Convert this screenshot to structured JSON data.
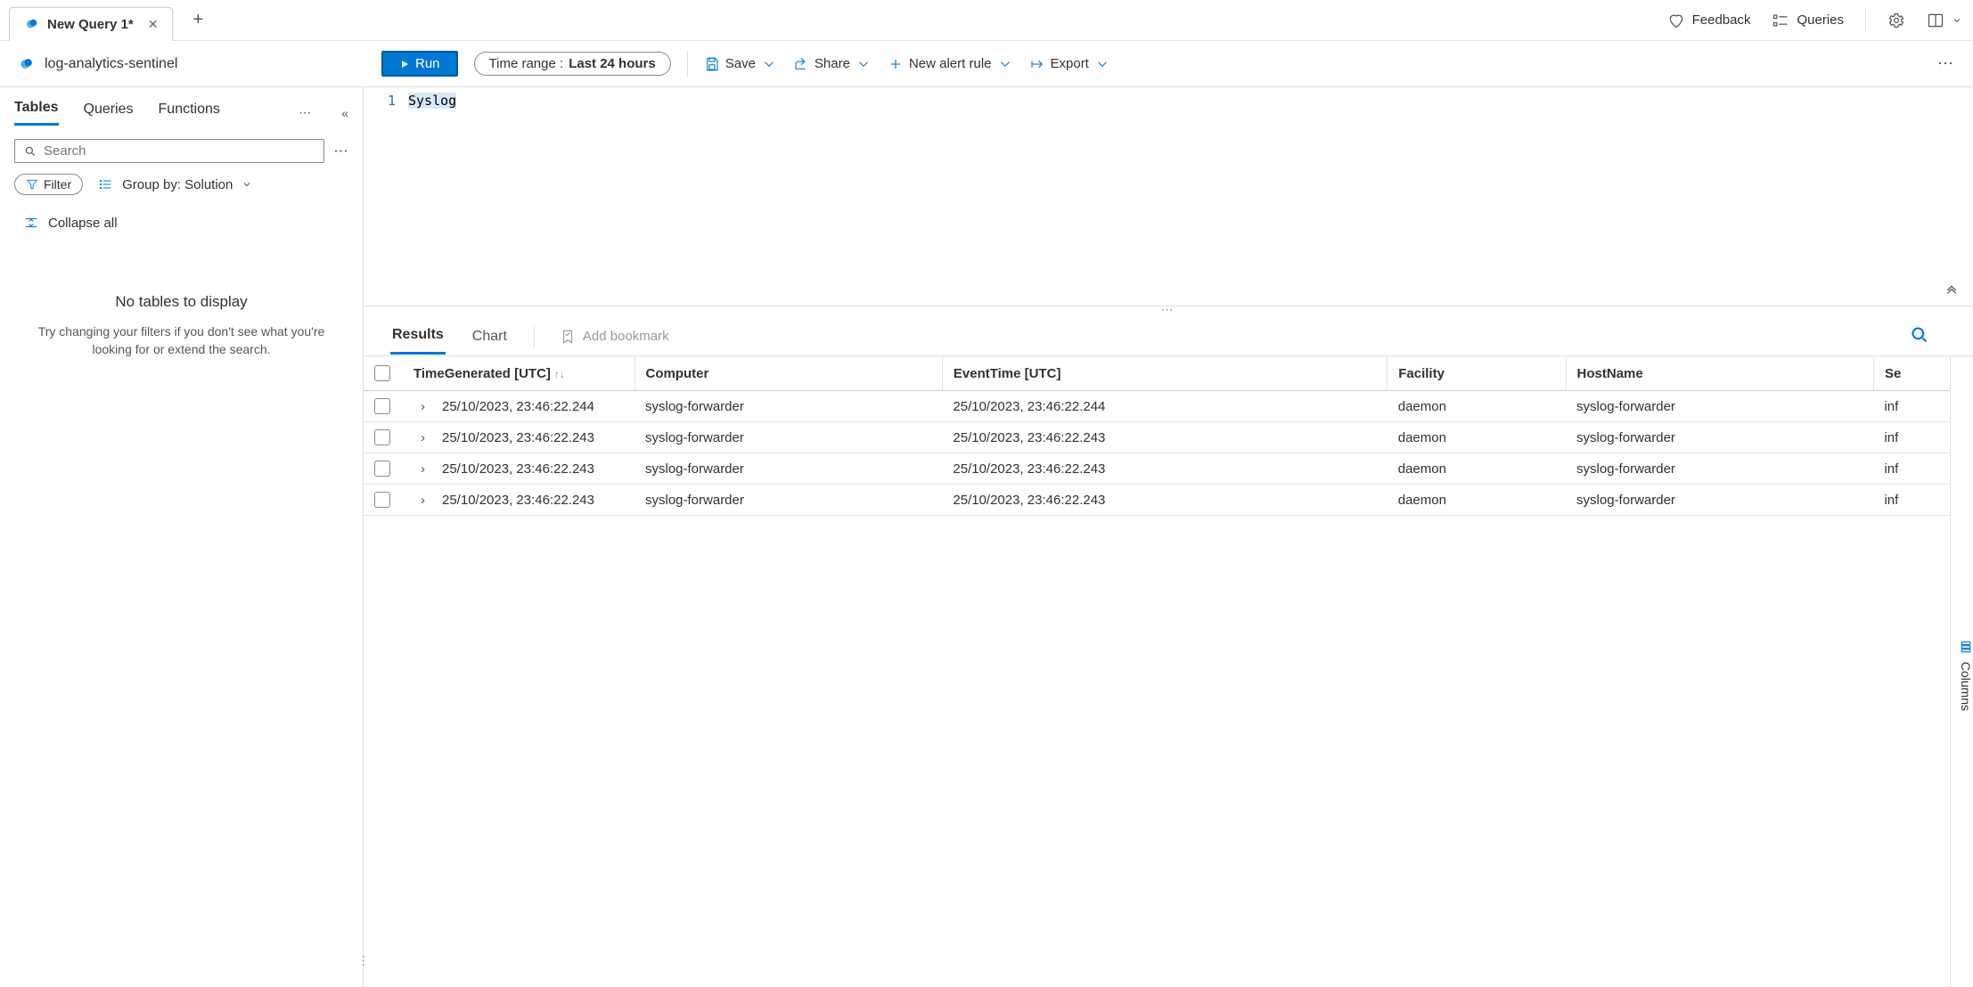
{
  "tab": {
    "title": "New Query 1*"
  },
  "topRight": {
    "feedback": "Feedback",
    "queries": "Queries"
  },
  "workspace": {
    "name": "log-analytics-sentinel"
  },
  "toolbar": {
    "run": "Run",
    "timeRangeLabel": "Time range :",
    "timeRangeValue": "Last 24 hours",
    "save": "Save",
    "share": "Share",
    "newAlert": "New alert rule",
    "export": "Export"
  },
  "sidebar": {
    "tabs": {
      "tables": "Tables",
      "queries": "Queries",
      "functions": "Functions"
    },
    "searchPlaceholder": "Search",
    "filter": "Filter",
    "groupBy": "Group by: Solution",
    "collapseAll": "Collapse all",
    "empty": {
      "title": "No tables to display",
      "desc": "Try changing your filters if you don't see what you're looking for or extend the search."
    }
  },
  "editor": {
    "lineNum": "1",
    "code": "Syslog"
  },
  "results": {
    "tabs": {
      "results": "Results",
      "chart": "Chart"
    },
    "addBookmark": "Add bookmark",
    "columnsLabel": "Columns",
    "columns": [
      "TimeGenerated [UTC]",
      "Computer",
      "EventTime [UTC]",
      "Facility",
      "HostName",
      "Se"
    ],
    "rows": [
      {
        "time": "25/10/2023, 23:46:22.244",
        "computer": "syslog-forwarder",
        "eventTime": "25/10/2023, 23:46:22.244",
        "facility": "daemon",
        "host": "syslog-forwarder",
        "sev": "inf"
      },
      {
        "time": "25/10/2023, 23:46:22.243",
        "computer": "syslog-forwarder",
        "eventTime": "25/10/2023, 23:46:22.243",
        "facility": "daemon",
        "host": "syslog-forwarder",
        "sev": "inf"
      },
      {
        "time": "25/10/2023, 23:46:22.243",
        "computer": "syslog-forwarder",
        "eventTime": "25/10/2023, 23:46:22.243",
        "facility": "daemon",
        "host": "syslog-forwarder",
        "sev": "inf"
      },
      {
        "time": "25/10/2023, 23:46:22.243",
        "computer": "syslog-forwarder",
        "eventTime": "25/10/2023, 23:46:22.243",
        "facility": "daemon",
        "host": "syslog-forwarder",
        "sev": "inf"
      }
    ]
  }
}
